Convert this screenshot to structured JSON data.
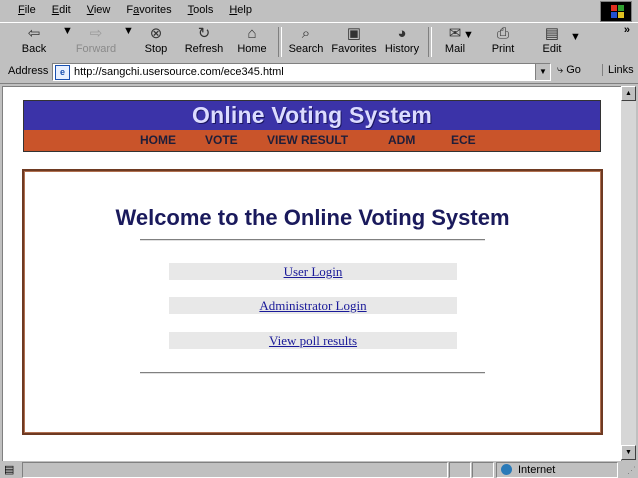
{
  "menu": {
    "items": [
      {
        "pre": "",
        "u": "F",
        "post": "ile"
      },
      {
        "pre": "",
        "u": "E",
        "post": "dit"
      },
      {
        "pre": "",
        "u": "V",
        "post": "iew"
      },
      {
        "pre": "F",
        "u": "a",
        "post": "vorites"
      },
      {
        "pre": "",
        "u": "T",
        "post": "ools"
      },
      {
        "pre": "",
        "u": "H",
        "post": "elp"
      }
    ]
  },
  "toolbar": {
    "back": "Back",
    "forward": "Forward",
    "stop": "Stop",
    "refresh": "Refresh",
    "home": "Home",
    "search": "Search",
    "favorites": "Favorites",
    "history": "History",
    "mail": "Mail",
    "print": "Print",
    "edit": "Edit",
    "more": "»"
  },
  "address": {
    "label": "Address",
    "url": "http://sangchi.usersource.com/ece345.html",
    "go": "Go",
    "links": "Links"
  },
  "page": {
    "banner_title": "Online Voting System",
    "nav": [
      "HOME",
      "VOTE",
      "VIEW RESULT",
      "ADM",
      "ECE"
    ],
    "welcome": "Welcome to the Online Voting System",
    "links": [
      "User Login",
      "Administrator Login",
      "View poll results"
    ]
  },
  "status": {
    "zone": "Internet"
  },
  "colors": {
    "banner_blue": "#3b33a8",
    "nav_orange": "#c9542a",
    "box_border": "#6e3a22",
    "link": "#1a1a99"
  }
}
